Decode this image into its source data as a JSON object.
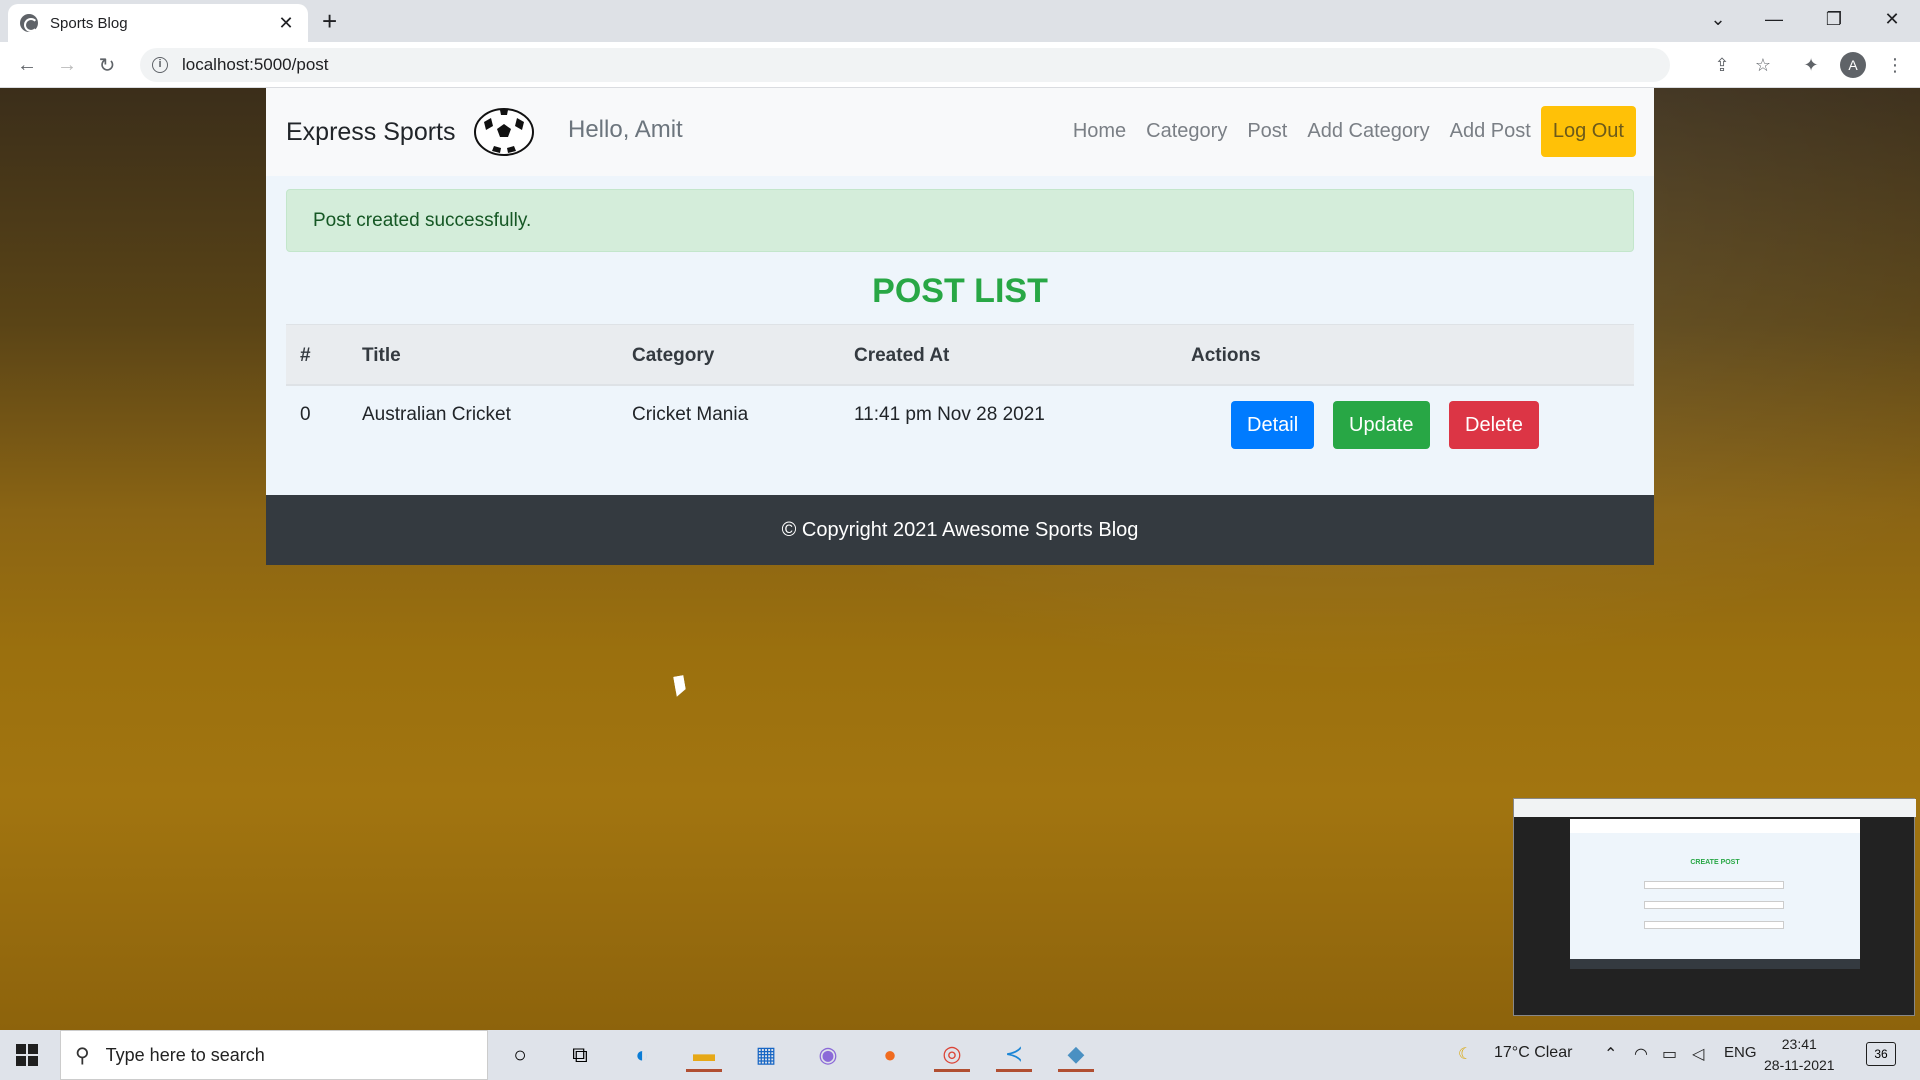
{
  "browser": {
    "tab_title": "Sports Blog",
    "tab_close": "✕",
    "new_tab": "+",
    "url": "localhost:5000/post",
    "avatar_letter": "A"
  },
  "site": {
    "brand": "Express Sports",
    "greeting": "Hello, Amit",
    "nav": [
      "Home",
      "Category",
      "Post",
      "Add Category",
      "Add Post"
    ],
    "logout": "Log Out"
  },
  "alert": "Post created successfully.",
  "heading": "POST LIST",
  "table": {
    "headers": [
      "#",
      "Title",
      "Category",
      "Created At",
      "Actions"
    ],
    "rows": [
      {
        "index": "0",
        "title": "Australian Cricket",
        "category": "Cricket Mania",
        "created_at": "11:41 pm Nov 28 2021"
      }
    ],
    "actions": {
      "detail": "Detail",
      "update": "Update",
      "delete": "Delete"
    }
  },
  "footer": "© Copyright 2021 Awesome Sports Blog",
  "thumbnail": {
    "heading": "CREATE POST"
  },
  "taskbar": {
    "search_placeholder": "Type here to search",
    "weather": "17°C  Clear",
    "language": "ENG",
    "time": "23:41",
    "date": "28-11-2021",
    "notifications": "36"
  },
  "colors": {
    "success": "#28a745",
    "primary": "#007bff",
    "danger": "#dc3545",
    "warning": "#ffc107",
    "footer": "#343a40"
  }
}
